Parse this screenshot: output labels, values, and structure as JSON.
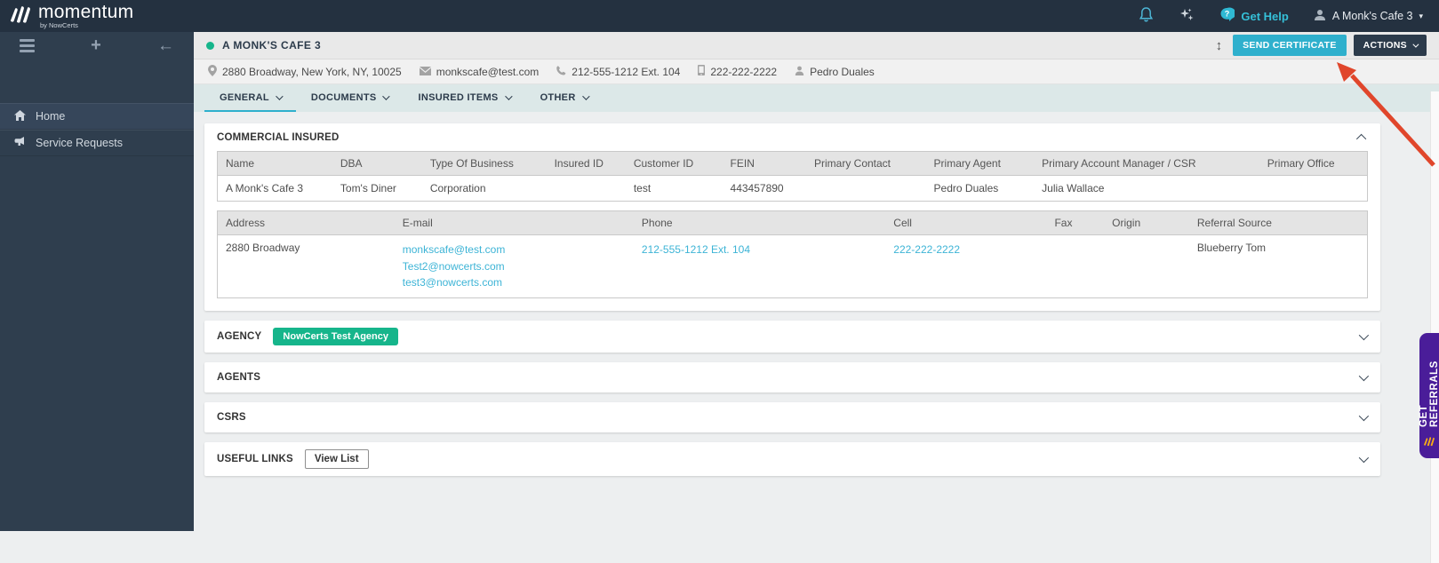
{
  "topbar": {
    "brand": {
      "name": "momentum",
      "byline": "by NowCerts"
    },
    "get_help_label": "Get Help",
    "account_label": "A Monk's Cafe 3"
  },
  "sidebar": {
    "items": [
      {
        "label": "Home",
        "icon": "home-icon"
      },
      {
        "label": "Service Requests",
        "icon": "megaphone-icon"
      }
    ]
  },
  "header": {
    "title": "A MONK'S CAFE 3",
    "send_certificate_label": "SEND CERTIFICATE",
    "actions_label": "ACTIONS",
    "resize_icon_glyph": "↕"
  },
  "contact_bar": {
    "address": "2880 Broadway, New York, NY, 10025",
    "email": "monkscafe@test.com",
    "phone": "212-555-1212 Ext. 104",
    "cell": "222-222-2222",
    "contact_name": "Pedro Duales"
  },
  "tabs": [
    {
      "label": "GENERAL",
      "active": true
    },
    {
      "label": "DOCUMENTS",
      "active": false
    },
    {
      "label": "INSURED ITEMS",
      "active": false
    },
    {
      "label": "OTHER",
      "active": false
    }
  ],
  "commercial_insured": {
    "title": "COMMERCIAL INSURED",
    "table1": {
      "headers": [
        "Name",
        "DBA",
        "Type Of Business",
        "Insured ID",
        "Customer ID",
        "FEIN",
        "Primary Contact",
        "Primary Agent",
        "Primary Account Manager / CSR",
        "Primary Office"
      ],
      "row": [
        "A Monk's Cafe 3",
        "Tom's Diner",
        "Corporation",
        "",
        "test",
        "443457890",
        "",
        "Pedro Duales",
        "Julia Wallace",
        ""
      ]
    },
    "table2": {
      "headers": [
        "Address",
        "E-mail",
        "Phone",
        "Cell",
        "Fax",
        "Origin",
        "Referral Source"
      ],
      "row": {
        "address": "2880 Broadway",
        "emails": [
          "monkscafe@test.com",
          "Test2@nowcerts.com",
          "test3@nowcerts.com"
        ],
        "phone": "212-555-1212 Ext. 104",
        "cell": "222-222-2222",
        "fax": "",
        "origin": "",
        "referral_source": "Blueberry Tom"
      }
    }
  },
  "sections": {
    "agency": {
      "title": "AGENCY",
      "badge": "NowCerts Test Agency"
    },
    "agents": {
      "title": "AGENTS"
    },
    "csrs": {
      "title": "CSRS"
    },
    "useful_links": {
      "title": "USEFUL LINKS",
      "button_label": "View List"
    }
  },
  "referrals_tab": {
    "label": "GET REFERRALS"
  },
  "colors": {
    "accent_teal": "#2fb0cd",
    "link_teal": "#3db4d6",
    "brand_navy": "#243140",
    "badge_green": "#16b58b",
    "referral_purple": "#4a1d99",
    "annotation_red": "#e0462b"
  }
}
